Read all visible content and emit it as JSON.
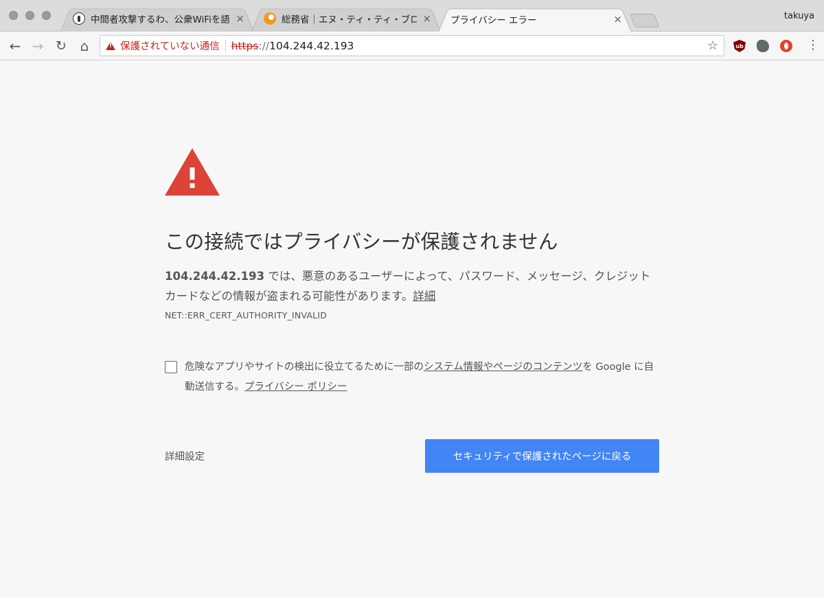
{
  "window": {
    "profile_name": "takuya"
  },
  "tabs": [
    {
      "title": "中間者攻撃するわ、公衆WiFiを語る",
      "favicon": "monochrome-circle-icon",
      "close": "×"
    },
    {
      "title": "総務省｜エヌ・ティ・ティ・ブロー",
      "favicon": "orange-bubble-icon",
      "close": "×"
    },
    {
      "title": "プライバシー エラー",
      "favicon": "",
      "close": "×"
    }
  ],
  "toolbar": {
    "back": "←",
    "forward": "→",
    "reload": "↻",
    "home": "⌂",
    "security_label": "保護されていない通信",
    "url_scheme": "https",
    "url_scheme_rest": "://",
    "url_host": "104.244.42.193",
    "bookmark_star": "☆",
    "menu": "⋮",
    "extensions": [
      "ublock-icon",
      "evernote-icon",
      "opera-icon"
    ],
    "ublock_badge": "ub"
  },
  "interstitial": {
    "headline": "この接続ではプライバシーが保護されません",
    "desc_host": "104.244.42.193",
    "desc_text": " では、悪意のあるユーザーによって、パスワード、メッセージ、クレジット カードなどの情報が盗まれる可能性があります。",
    "details_link": "詳細",
    "error_code": "NET::ERR_CERT_AUTHORITY_INVALID",
    "optin_prefix": "危険なアプリやサイトの検出に役立てるために一部の",
    "optin_link": "システム情報やページのコンテンツ",
    "optin_middle": "を Google に自動送信する。",
    "privacy_link": "プライバシー ポリシー",
    "advanced_label": "詳細設定",
    "back_button_label": "セキュリティで保護されたページに戻る"
  },
  "colors": {
    "warning_red": "#db4437",
    "insecure_red": "#c5221f",
    "primary_blue": "#4285f4",
    "page_bg": "#f7f7f7"
  }
}
